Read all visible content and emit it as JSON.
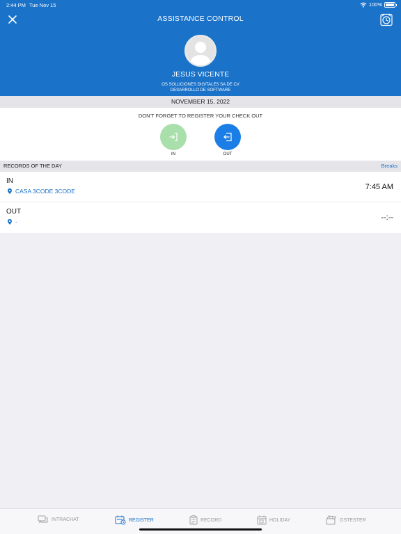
{
  "status_bar": {
    "time": "2:44 PM",
    "date": "Tue Nov 15",
    "battery": "100%"
  },
  "nav": {
    "title": "ASSISTANCE CONTROL",
    "close_icon": "close-icon",
    "alarm_icon": "alarm-clock-icon"
  },
  "profile": {
    "name": "JESUS VICENTE",
    "company_line1": "OS SOLUCIONES DIGITALES SA DE CV",
    "company_line2": "DESARROLLO DE SOFTWARE"
  },
  "date_strip": "NOVEMBER 15, 2022",
  "checkin": {
    "reminder": "DON'T FORGET TO REGISTER YOUR CHECK OUT",
    "in_label": "IN",
    "out_label": "OUT"
  },
  "records": {
    "header": "RECORDS OF THE DAY",
    "breaks_link": "Breaks",
    "items": [
      {
        "type": "IN",
        "location": "CASA 3CODE 3CODE",
        "time": "7:45 AM"
      },
      {
        "type": "OUT",
        "location": "-",
        "time": "--:--"
      }
    ]
  },
  "tabs": [
    {
      "label": "INTRACHAT",
      "icon": "chat-icon",
      "active": false
    },
    {
      "label": "REGISTER",
      "icon": "register-icon",
      "active": true
    },
    {
      "label": "RECORD",
      "icon": "clipboard-icon",
      "active": false
    },
    {
      "label": "HOLIDAY",
      "icon": "calendar-icon",
      "active": false
    },
    {
      "label": "GSTESTER",
      "icon": "tester-icon",
      "active": false
    }
  ],
  "colors": {
    "primary": "#1a72c9",
    "in_button": "#a9dfaa",
    "out_button": "#1a7ee6",
    "background": "#efeff4"
  }
}
